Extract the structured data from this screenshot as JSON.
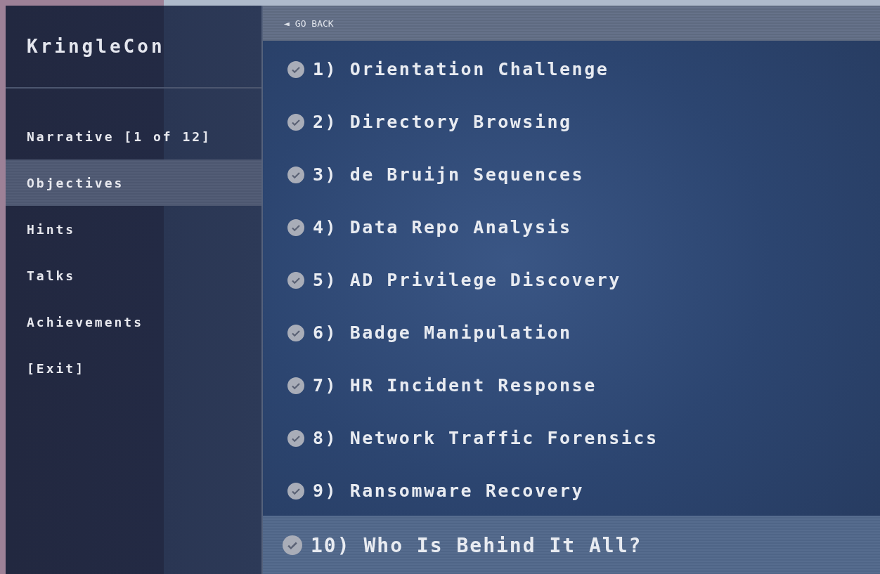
{
  "sidebar": {
    "title": "KringleCon",
    "items": [
      {
        "label": "Narrative [1 of 12]",
        "selected": false
      },
      {
        "label": "Objectives",
        "selected": true
      },
      {
        "label": "Hints",
        "selected": false
      },
      {
        "label": "Talks",
        "selected": false
      },
      {
        "label": "Achievements",
        "selected": false
      },
      {
        "label": "[Exit]",
        "selected": false
      }
    ]
  },
  "back": {
    "arrow": "◄",
    "label": "GO BACK"
  },
  "objectives": [
    {
      "label": "1) Orientation Challenge",
      "completed": true,
      "selected": false
    },
    {
      "label": "2) Directory Browsing",
      "completed": true,
      "selected": false
    },
    {
      "label": "3) de Bruijn Sequences",
      "completed": true,
      "selected": false
    },
    {
      "label": "4) Data Repo Analysis",
      "completed": true,
      "selected": false
    },
    {
      "label": "5) AD Privilege Discovery",
      "completed": true,
      "selected": false
    },
    {
      "label": "6) Badge Manipulation",
      "completed": true,
      "selected": false
    },
    {
      "label": "7) HR Incident Response",
      "completed": true,
      "selected": false
    },
    {
      "label": "8) Network Traffic Forensics",
      "completed": true,
      "selected": false
    },
    {
      "label": "9) Ransomware Recovery",
      "completed": true,
      "selected": false
    },
    {
      "label": "10) Who Is Behind It All?",
      "completed": true,
      "selected": true
    }
  ]
}
